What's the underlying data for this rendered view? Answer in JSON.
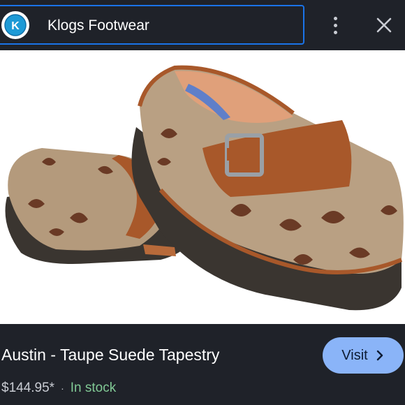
{
  "header": {
    "site_name": "Klogs Footwear",
    "logo_letter": "K",
    "menu_icon": "more-vert-icon",
    "close_icon": "close-icon"
  },
  "product": {
    "title": "Austin - Taupe Suede Tapestry",
    "price": "$144.95*",
    "separator": "·",
    "availability": "In stock",
    "image_alt": "Pair of taupe suede tapestry clogs with brown leather strap and buckle"
  },
  "actions": {
    "visit_label": "Visit",
    "visit_icon": "chevron-right-icon"
  },
  "colors": {
    "background": "#1f2229",
    "accent": "#8ab4f8",
    "in_stock": "#81c995",
    "focus_outline": "#1a73e8"
  }
}
